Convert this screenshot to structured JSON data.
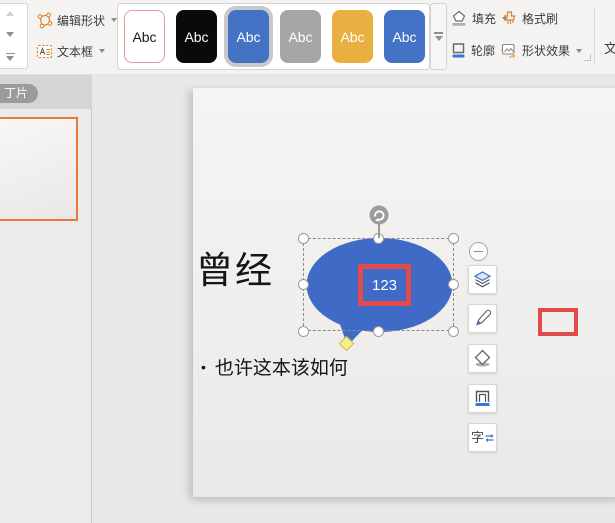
{
  "toolbar": {
    "edit_shape": {
      "label": "编辑形状"
    },
    "text_box": {
      "label": "文本框"
    },
    "style_gallery": {
      "swatches": [
        {
          "label": "Abc",
          "fill": "#ffffff",
          "text_color": "#1a1a1a",
          "border": "#e89a9a",
          "selected": false
        },
        {
          "label": "Abc",
          "fill": "#0a0a0a",
          "text_color": "#ffffff",
          "border": "#0a0a0a",
          "selected": false
        },
        {
          "label": "Abc",
          "fill": "#4472c4",
          "text_color": "#ffffff",
          "border": "#4472c4",
          "selected": true
        },
        {
          "label": "Abc",
          "fill": "#a6a6a6",
          "text_color": "#ffffff",
          "border": "#a6a6a6",
          "selected": false
        },
        {
          "label": "Abc",
          "fill": "#e8af41",
          "text_color": "#ffffff",
          "border": "#e8af41",
          "selected": false
        },
        {
          "label": "Abc",
          "fill": "#4472c4",
          "text_color": "#ffffff",
          "border": "#4472c4",
          "selected": false
        }
      ]
    },
    "fill": {
      "label": "填充"
    },
    "format_painter": {
      "label": "格式刷"
    },
    "outline": {
      "label": "轮廓"
    },
    "shape_effects": {
      "label": "形状效果"
    },
    "clipped_right_label": "文"
  },
  "sidebar": {
    "slides_tab_label": "丁片"
  },
  "slide": {
    "title": "曾经",
    "bullet_marker": "•",
    "bullet": "也许这本该如何",
    "callout": {
      "text": "123",
      "fill_color": "#3f6bc6"
    }
  },
  "floating_toolbar": {
    "text_button_label": "字"
  },
  "icons": {
    "edit-shape-icon": "polygon-with-vertex-nodes",
    "text-box-icon": "dashed-box-with-A",
    "fill-icon": "paint-bucket-with-gray-bar",
    "format-painter-icon": "orange-brush",
    "outline-icon": "square-with-blue-bar",
    "shape-effects-icon": "picture-with-sparkles",
    "collapse-icon": "minus-in-circle",
    "layers-icon": "stacked-diamonds",
    "brush-icon": "paint-brush",
    "bucket-icon": "tilted-square-pour",
    "frame-icon": "double-square-blue-bar",
    "text-layout-icon": "char-with-blue-arrows",
    "rotate-icon": "circular-arrow",
    "dropdown-caret-icon": "small-down-triangle"
  },
  "colors": {
    "accent_red": "#e14b4b",
    "selection_orange": "#e8793b",
    "callout_blue": "#3f6bc6",
    "icon_orange": "#d9822b"
  }
}
